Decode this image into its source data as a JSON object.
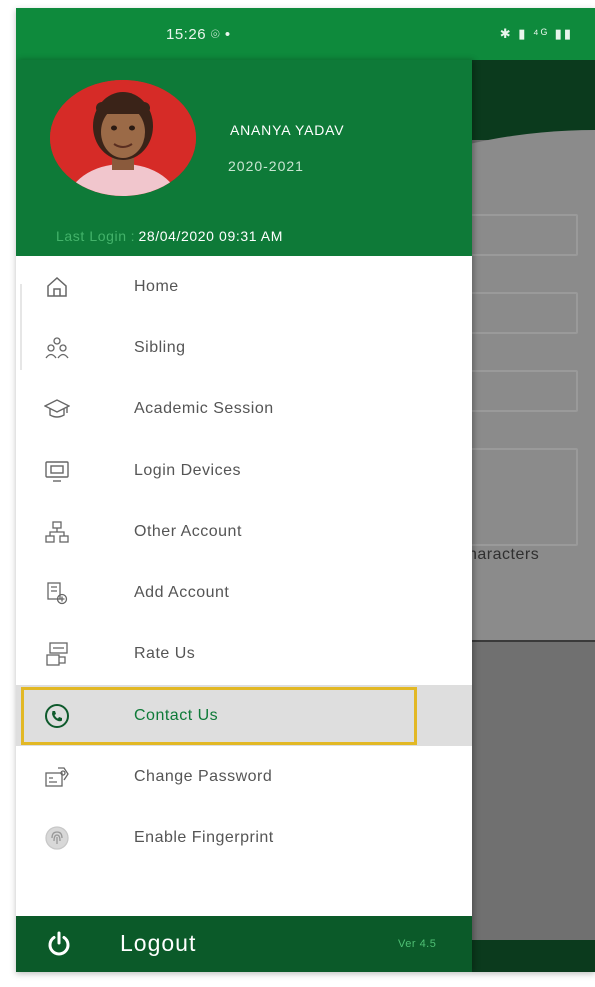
{
  "status_bar": {
    "time": "15:26",
    "indicators": "⌾ •",
    "system_icons": "✱ ▮ ⁴ᴳ ▮▮"
  },
  "profile": {
    "name": "ANANYA YADAV",
    "session": "2020-2021",
    "last_login_label": "Last Login",
    "last_login_separator": ":",
    "last_login_value": "28/04/2020  09:31 AM"
  },
  "menu": {
    "items": [
      {
        "label": "Home",
        "icon": "home-icon"
      },
      {
        "label": "Sibling",
        "icon": "sibling-icon"
      },
      {
        "label": "Academic Session",
        "icon": "graduation-cap-icon"
      },
      {
        "label": "Login Devices",
        "icon": "monitor-icon"
      },
      {
        "label": "Other Account",
        "icon": "network-icon"
      },
      {
        "label": "Add Account",
        "icon": "add-account-icon"
      },
      {
        "label": "Rate Us",
        "icon": "rate-icon"
      },
      {
        "label": "Contact Us",
        "icon": "phone-icon"
      },
      {
        "label": "Change Password",
        "icon": "password-icon"
      },
      {
        "label": "Enable Fingerprint",
        "icon": "fingerprint-icon"
      }
    ],
    "active_item": "Contact Us"
  },
  "footer": {
    "logout_label": "Logout",
    "version": "Ver 4.5"
  },
  "background": {
    "char_hint": "haracters"
  },
  "colors": {
    "primary_green": "#0e7a38",
    "status_green": "#0e8a3c",
    "highlight_border": "#e2b825"
  }
}
